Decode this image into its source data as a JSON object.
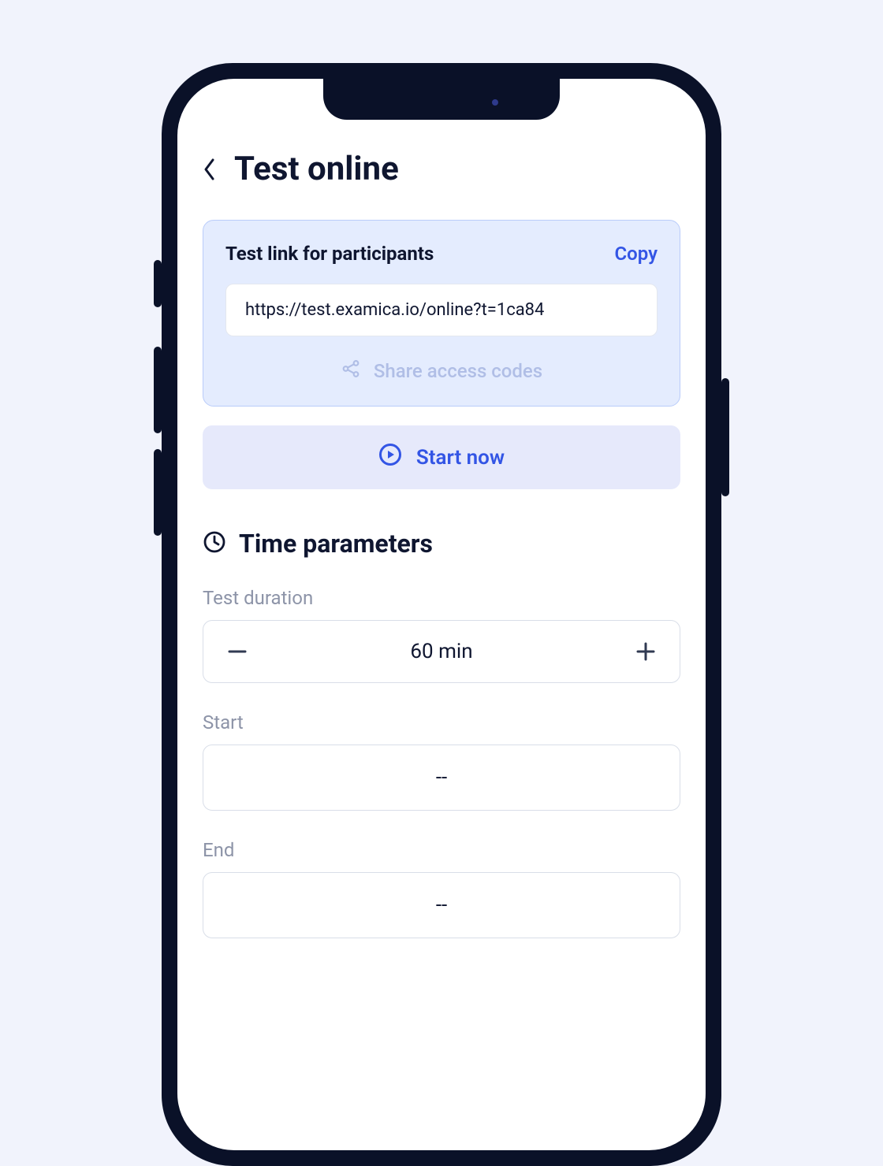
{
  "header": {
    "title": "Test online"
  },
  "link_card": {
    "title": "Test link for participants",
    "copy_label": "Copy",
    "url": "https://test.examica.io/online?t=1ca84",
    "share_label": "Share access codes"
  },
  "start": {
    "label": "Start now"
  },
  "time_section": {
    "title": "Time parameters",
    "duration_label": "Test duration",
    "duration_value": "60 min",
    "start_label": "Start",
    "start_value": "--",
    "end_label": "End",
    "end_value": "--"
  }
}
